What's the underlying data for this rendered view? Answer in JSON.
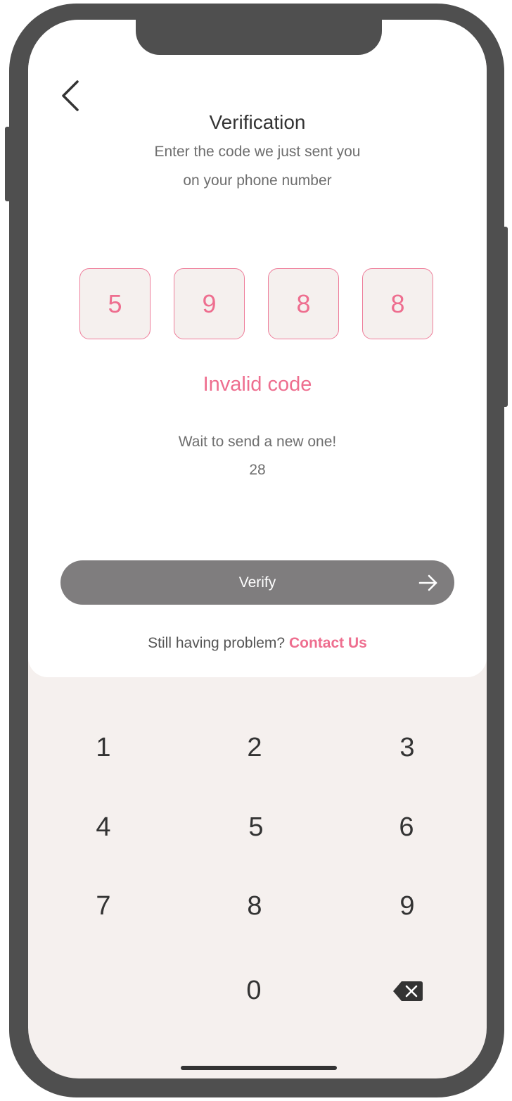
{
  "header": {
    "title": "Verification",
    "subtitle_line1": "Enter the code we just sent you",
    "subtitle_line2": "on your phone number"
  },
  "code": {
    "digits": [
      "5",
      "9",
      "8",
      "8"
    ],
    "error": "Invalid code"
  },
  "resend": {
    "message": "Wait to send a new one!",
    "countdown": "28"
  },
  "actions": {
    "verify_label": "Verify"
  },
  "help": {
    "text": "Still having problem?",
    "link": "Contact Us"
  },
  "keypad": {
    "keys": [
      "1",
      "2",
      "3",
      "4",
      "5",
      "6",
      "7",
      "8",
      "9",
      "0"
    ]
  },
  "colors": {
    "accent": "#ee6e8f",
    "button": "#7f7d7e",
    "device": "#4f4f4f",
    "keypad_bg": "#f5f0ee"
  },
  "icons": {
    "back": "chevron-left-icon",
    "verify_arrow": "arrow-right-icon",
    "delete": "backspace-icon"
  }
}
